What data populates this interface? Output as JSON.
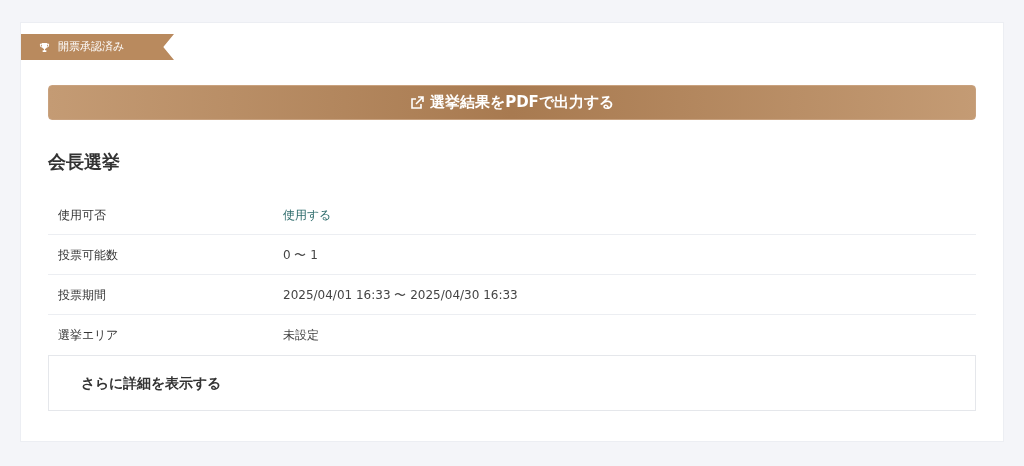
{
  "status_ribbon": {
    "label": "開票承認済み"
  },
  "export_button": {
    "label": "選挙結果をPDFで出力する"
  },
  "title": "会長選挙",
  "rows": [
    {
      "label": "使用可否",
      "value": "使用する",
      "kind": "link"
    },
    {
      "label": "投票可能数",
      "value": "0 〜 1",
      "kind": "text"
    },
    {
      "label": "投票期間",
      "value": "2025/04/01 16:33 〜 2025/04/30 16:33",
      "kind": "text"
    },
    {
      "label": "選挙エリア",
      "value": "未設定",
      "kind": "text"
    }
  ],
  "more_details": {
    "label": "さらに詳細を表示する"
  }
}
